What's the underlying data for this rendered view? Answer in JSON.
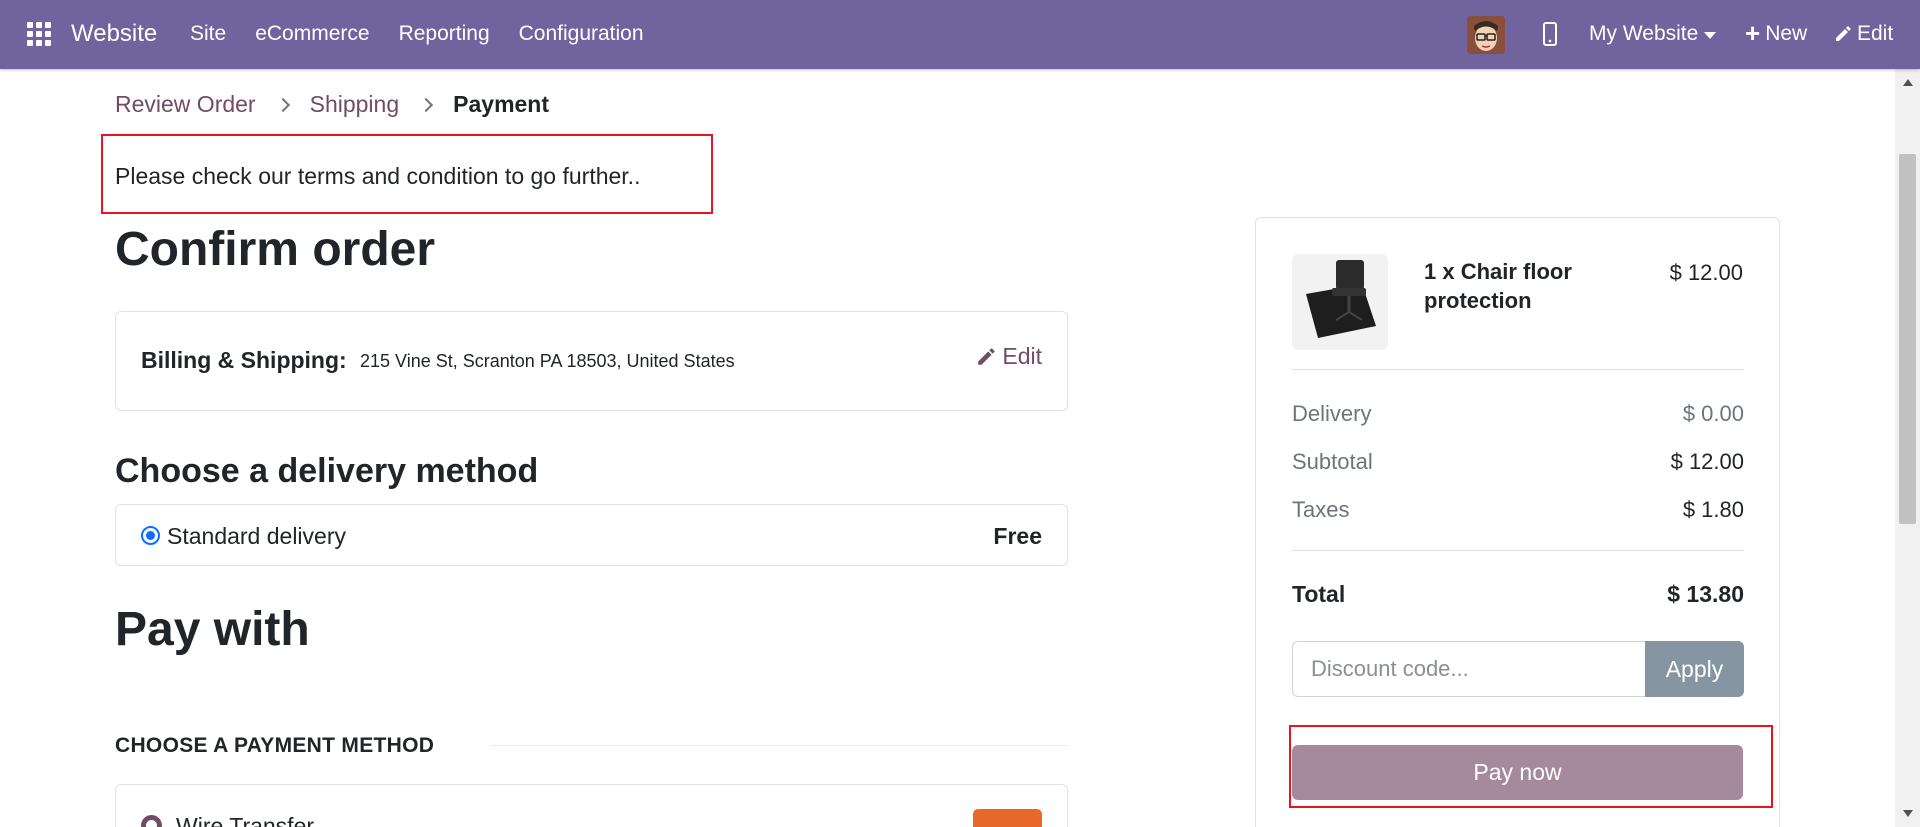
{
  "navbar": {
    "brand": "Website",
    "menu": [
      "Site",
      "eCommerce",
      "Reporting",
      "Configuration"
    ],
    "website_selector": "My Website",
    "new_label": "New",
    "edit_label": "Edit"
  },
  "breadcrumb": {
    "items": [
      "Review Order",
      "Shipping"
    ],
    "active": "Payment"
  },
  "terms_warning": "Please check our terms and condition to go further..",
  "confirm_title": "Confirm order",
  "billing": {
    "label": "Billing & Shipping:",
    "address": "215 Vine St, Scranton PA 18503, United States",
    "edit_label": "Edit"
  },
  "delivery": {
    "title": "Choose a delivery method",
    "method_name": "Standard delivery",
    "method_price": "Free",
    "selected": true
  },
  "payment": {
    "title": "Pay with",
    "section_heading": "CHOOSE A PAYMENT METHOD",
    "method_name": "Wire Transfer"
  },
  "summary": {
    "product_name": "1 x Chair floor protection",
    "product_price": "$ 12.00",
    "delivery_label": "Delivery",
    "delivery_value": "$ 0.00",
    "subtotal_label": "Subtotal",
    "subtotal_value": "$ 12.00",
    "taxes_label": "Taxes",
    "taxes_value": "$ 1.80",
    "total_label": "Total",
    "total_value": "$ 13.80",
    "discount_placeholder": "Discount code...",
    "apply_label": "Apply",
    "pay_label": "Pay now"
  },
  "colors": {
    "navbar": "#71639e",
    "link": "#714b67",
    "highlight": "#e8151f",
    "pay_button": "#a58a9d",
    "apply_button": "#8595a2"
  }
}
